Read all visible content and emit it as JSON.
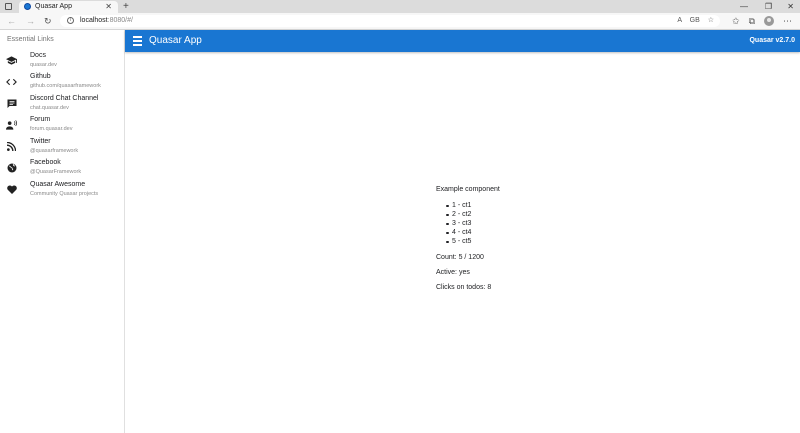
{
  "browser": {
    "tab_title": "Quasar App",
    "tab_close": "✕",
    "new_tab": "+",
    "url_host": "localhost",
    "url_rest": ":8080/#/",
    "url_icons": [
      "A",
      "GB"
    ],
    "window_controls": [
      "—",
      "❐",
      "✕"
    ]
  },
  "drawer": {
    "header": "Essential Links",
    "items": [
      {
        "title": "Docs",
        "caption": "quasar.dev",
        "icon": "school-icon"
      },
      {
        "title": "Github",
        "caption": "github.com/quasarframework",
        "icon": "code-icon"
      },
      {
        "title": "Discord Chat Channel",
        "caption": "chat.quasar.dev",
        "icon": "chat-icon"
      },
      {
        "title": "Forum",
        "caption": "forum.quasar.dev",
        "icon": "record-voice-icon"
      },
      {
        "title": "Twitter",
        "caption": "@quasarframework",
        "icon": "rss-feed-icon"
      },
      {
        "title": "Facebook",
        "caption": "@QuasarFramework",
        "icon": "public-icon"
      },
      {
        "title": "Quasar Awesome",
        "caption": "Community Quasar projects",
        "icon": "favorite-icon"
      }
    ]
  },
  "appbar": {
    "title": "Quasar App",
    "version": "Quasar v2.7.0",
    "color": "#1976d2"
  },
  "example": {
    "heading": "Example component",
    "todos": [
      "1 - ct1",
      "2 - ct2",
      "3 - ct3",
      "4 - ct4",
      "5 - ct5"
    ],
    "count": "Count: 5 / 1200",
    "active": "Active: yes",
    "clicks": "Clicks on todos: 8"
  }
}
